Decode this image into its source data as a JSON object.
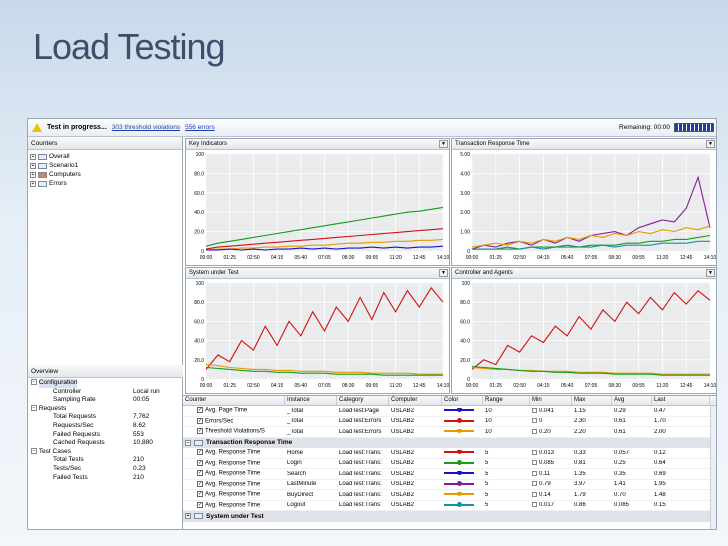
{
  "slide": {
    "title": "Load Testing"
  },
  "status": {
    "text": "Test in progress...",
    "violations": "303 threshold violations",
    "errors": "556 errors",
    "remaining": "Remaining: 00:00"
  },
  "counters": {
    "header": "Counters",
    "items": [
      "Overall",
      "Scenario1",
      "Computers",
      "Errors"
    ]
  },
  "overview": {
    "header": "Overview",
    "configuration": {
      "label": "Configuration",
      "rows": [
        {
          "k": "Controller",
          "v": "Local run"
        },
        {
          "k": "Sampling Rate",
          "v": "00:05"
        }
      ]
    },
    "requests": {
      "label": "Requests",
      "rows": [
        {
          "k": "Total Requests",
          "v": "7,762"
        },
        {
          "k": "Requests/Sec",
          "v": "8.62"
        },
        {
          "k": "Failed Requests",
          "v": "553"
        },
        {
          "k": "Cached Requests",
          "v": "10,880"
        }
      ]
    },
    "testcases": {
      "label": "Test Cases",
      "rows": [
        {
          "k": "Total Tests",
          "v": "210"
        },
        {
          "k": "Tests/Sec",
          "v": "0.23"
        },
        {
          "k": "Failed Tests",
          "v": "210"
        }
      ]
    }
  },
  "charts": [
    {
      "title": "Key Indicators",
      "yticks": [
        "100",
        "80.0",
        "60.0",
        "40.0",
        "20.0",
        "0"
      ],
      "ymax": 100,
      "series": [
        {
          "color": "#1a9a1a",
          "values": [
            5,
            8,
            10,
            12,
            14,
            16,
            18,
            20,
            22,
            24,
            26,
            28,
            30,
            32,
            34,
            36,
            38,
            40,
            41,
            43,
            45
          ]
        },
        {
          "color": "#d41010",
          "values": [
            2,
            4,
            5,
            6,
            7,
            8,
            9,
            10,
            11,
            12,
            13,
            14,
            15,
            16,
            17,
            18,
            19,
            20,
            21,
            22,
            23
          ]
        },
        {
          "color": "#e89a00",
          "values": [
            1,
            2,
            2,
            3,
            3,
            4,
            4,
            5,
            5,
            6,
            6,
            7,
            8,
            8,
            9,
            9,
            10,
            10,
            11,
            11,
            12
          ]
        },
        {
          "color": "#1515c8",
          "values": [
            1,
            1,
            2,
            1,
            2,
            1,
            2,
            2,
            3,
            2,
            3,
            2,
            3,
            3,
            4,
            3,
            4,
            3,
            4,
            4,
            5
          ]
        }
      ]
    },
    {
      "title": "Transaction Response Time",
      "yticks": [
        "5.00",
        "4.00",
        "3.00",
        "2.00",
        "1.00",
        "0"
      ],
      "ymax": 5,
      "series": [
        {
          "color": "#8a1a9a",
          "values": [
            0.1,
            0.3,
            0.2,
            0.4,
            0.5,
            0.3,
            0.6,
            0.4,
            0.7,
            0.5,
            0.8,
            0.9,
            1.0,
            0.8,
            1.2,
            1.4,
            1.6,
            1.5,
            2.2,
            3.8,
            1.2
          ]
        },
        {
          "color": "#1a9a1a",
          "values": [
            0.1,
            0.1,
            0.1,
            0.2,
            0.1,
            0.2,
            0.2,
            0.2,
            0.3,
            0.2,
            0.3,
            0.3,
            0.3,
            0.4,
            0.4,
            0.5,
            0.5,
            0.6,
            0.6,
            0.7,
            0.8
          ]
        },
        {
          "color": "#e89a00",
          "values": [
            0.2,
            0.3,
            0.4,
            0.3,
            0.5,
            0.4,
            0.6,
            0.5,
            0.7,
            0.6,
            0.8,
            0.7,
            0.9,
            0.8,
            1.0,
            0.9,
            1.1,
            1.0,
            1.2,
            1.1,
            1.3
          ]
        },
        {
          "color": "#1590a0",
          "values": [
            0.1,
            0.1,
            0.1,
            0.1,
            0.1,
            0.2,
            0.1,
            0.2,
            0.2,
            0.2,
            0.2,
            0.3,
            0.2,
            0.3,
            0.3,
            0.3,
            0.4,
            0.4,
            0.4,
            0.5,
            0.5
          ]
        }
      ]
    },
    {
      "title": "System under Test",
      "yticks": [
        "100",
        "80.0",
        "60.0",
        "40.0",
        "20.0",
        "0"
      ],
      "ymax": 100,
      "series": [
        {
          "color": "#d41010",
          "values": [
            10,
            25,
            18,
            40,
            30,
            55,
            35,
            60,
            45,
            70,
            50,
            75,
            60,
            85,
            62,
            90,
            70,
            92,
            75,
            95,
            80
          ]
        },
        {
          "color": "#e89a00",
          "values": [
            15,
            14,
            12,
            11,
            10,
            10,
            9,
            9,
            8,
            8,
            8,
            7,
            7,
            7,
            6,
            6,
            6,
            6,
            5,
            5,
            5
          ]
        },
        {
          "color": "#1a9a1a",
          "values": [
            12,
            11,
            10,
            9,
            8,
            8,
            7,
            7,
            6,
            6,
            6,
            5,
            5,
            5,
            5,
            4,
            4,
            4,
            4,
            4,
            4
          ]
        }
      ]
    },
    {
      "title": "Controller and Agents",
      "yticks": [
        "100",
        "80.0",
        "60.0",
        "40.0",
        "20.0",
        "0"
      ],
      "ymax": 100,
      "series": [
        {
          "color": "#d41010",
          "values": [
            10,
            20,
            15,
            35,
            28,
            45,
            38,
            55,
            45,
            65,
            52,
            72,
            60,
            80,
            68,
            85,
            72,
            90,
            78,
            92,
            82
          ]
        },
        {
          "color": "#e89a00",
          "values": [
            12,
            11,
            10,
            10,
            9,
            9,
            8,
            8,
            8,
            7,
            7,
            7,
            6,
            6,
            6,
            6,
            5,
            5,
            5,
            5,
            5
          ]
        },
        {
          "color": "#1a9a1a",
          "values": [
            13,
            12,
            11,
            10,
            9,
            8,
            8,
            7,
            7,
            6,
            6,
            6,
            5,
            5,
            5,
            5,
            4,
            4,
            4,
            4,
            4
          ]
        }
      ]
    }
  ],
  "xticks": [
    "00:00",
    "01:25",
    "02:50",
    "04:15",
    "05:40",
    "07:05",
    "08:30",
    "09:55",
    "11:20",
    "12:45",
    "14:10"
  ],
  "grid": {
    "headers": [
      "Counter",
      "Instance",
      "Category",
      "Computer",
      "Color",
      "Range",
      "Min",
      "Max",
      "Avg",
      "Last"
    ],
    "rows": [
      {
        "counter": "Avg. Page Time",
        "instance": "_Total",
        "category": "LoadTest:Page",
        "computer": "USLAB2",
        "color": "#1515c8",
        "range": "10",
        "min": "0.041",
        "max": "1.15",
        "avg": "0.29",
        "last": "0.47"
      },
      {
        "counter": "Errors/Sec",
        "instance": "_Total",
        "category": "LoadTest:Errors",
        "computer": "USLAB2",
        "color": "#d41010",
        "range": "10",
        "min": "0",
        "max": "2.30",
        "avg": "0.61",
        "last": "1.70"
      },
      {
        "counter": "Threshold Violations/S",
        "instance": "_Total",
        "category": "LoadTest:Errors",
        "computer": "USLAB2",
        "color": "#e89a00",
        "range": "10",
        "min": "0.20",
        "max": "2.20",
        "avg": "0.61",
        "last": "2.00"
      }
    ],
    "group1": "Transaction Response Time",
    "rows2": [
      {
        "counter": "Avg. Response Time",
        "instance": "Home",
        "category": "LoadTest:Trans:",
        "computer": "USLAB2",
        "color": "#d41010",
        "range": "5",
        "min": "0.013",
        "max": "0.33",
        "avg": "0.057",
        "last": "0.12"
      },
      {
        "counter": "Avg. Response Time",
        "instance": "Login",
        "category": "LoadTest:Trans:",
        "computer": "USLAB2",
        "color": "#1a9a1a",
        "range": "5",
        "min": "0.085",
        "max": "0.81",
        "avg": "0.25",
        "last": "0.64"
      },
      {
        "counter": "Avg. Response Time",
        "instance": "Search",
        "category": "LoadTest:Trans:",
        "computer": "USLAB2",
        "color": "#1515c8",
        "range": "5",
        "min": "0.11",
        "max": "1.35",
        "avg": "0.35",
        "last": "0.69"
      },
      {
        "counter": "Avg. Response Time",
        "instance": "LastMinute",
        "category": "LoadTest:Trans:",
        "computer": "USLAB2",
        "color": "#8a1a9a",
        "range": "5",
        "min": "0.79",
        "max": "3.97",
        "avg": "1.41",
        "last": "1.95"
      },
      {
        "counter": "Avg. Response Time",
        "instance": "BuyDirect",
        "category": "LoadTest:Trans:",
        "computer": "USLAB2",
        "color": "#e89a00",
        "range": "5",
        "min": "0.14",
        "max": "1.79",
        "avg": "0.70",
        "last": "1.48"
      },
      {
        "counter": "Avg. Response Time",
        "instance": "Logout",
        "category": "LoadTest:Trans:",
        "computer": "USLAB2",
        "color": "#1590a0",
        "range": "5",
        "min": "0.017",
        "max": "0.86",
        "avg": "0.085",
        "last": "0.15"
      }
    ],
    "group2": "System under Test"
  }
}
